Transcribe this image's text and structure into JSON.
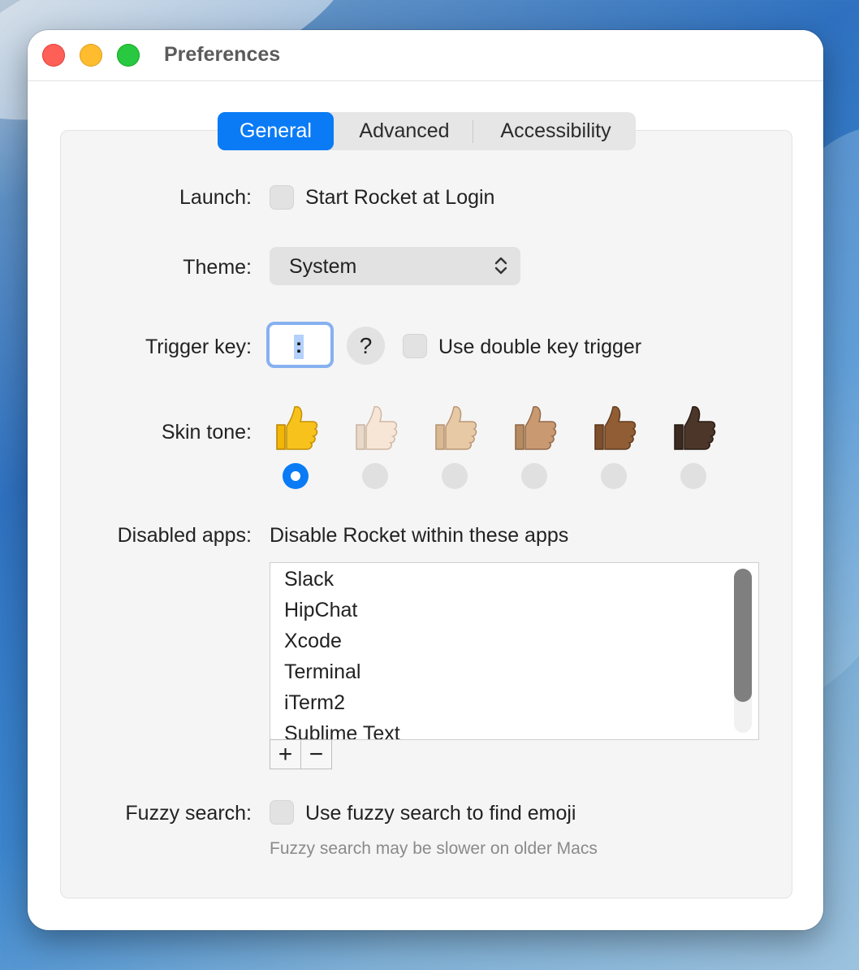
{
  "window": {
    "title": "Preferences"
  },
  "tabs": [
    {
      "label": "General",
      "active": true
    },
    {
      "label": "Advanced",
      "active": false
    },
    {
      "label": "Accessibility",
      "active": false
    }
  ],
  "launch": {
    "label": "Launch:",
    "checkbox_label": "Start Rocket at Login",
    "checked": false
  },
  "theme": {
    "label": "Theme:",
    "value": "System"
  },
  "trigger": {
    "label": "Trigger key:",
    "value": ":",
    "help": "?",
    "double_label": "Use double key trigger",
    "double_checked": false
  },
  "skin_tone": {
    "label": "Skin tone:",
    "selected_index": 0,
    "options": [
      "👍",
      "👍🏻",
      "👍🏼",
      "👍🏽",
      "👍🏾",
      "👍🏿"
    ]
  },
  "disabled_apps": {
    "label": "Disabled apps:",
    "description": "Disable Rocket within these apps",
    "apps": [
      "Slack",
      "HipChat",
      "Xcode",
      "Terminal",
      "iTerm2",
      "Sublime Text"
    ],
    "add": "+",
    "remove": "−"
  },
  "fuzzy": {
    "label": "Fuzzy search:",
    "checkbox_label": "Use fuzzy search to find emoji",
    "checked": false,
    "hint": "Fuzzy search may be slower on older Macs"
  },
  "colors": {
    "accent": "#0a7bf5",
    "close": "#fe5f57",
    "minimize": "#febc2e",
    "zoom": "#28c840"
  }
}
